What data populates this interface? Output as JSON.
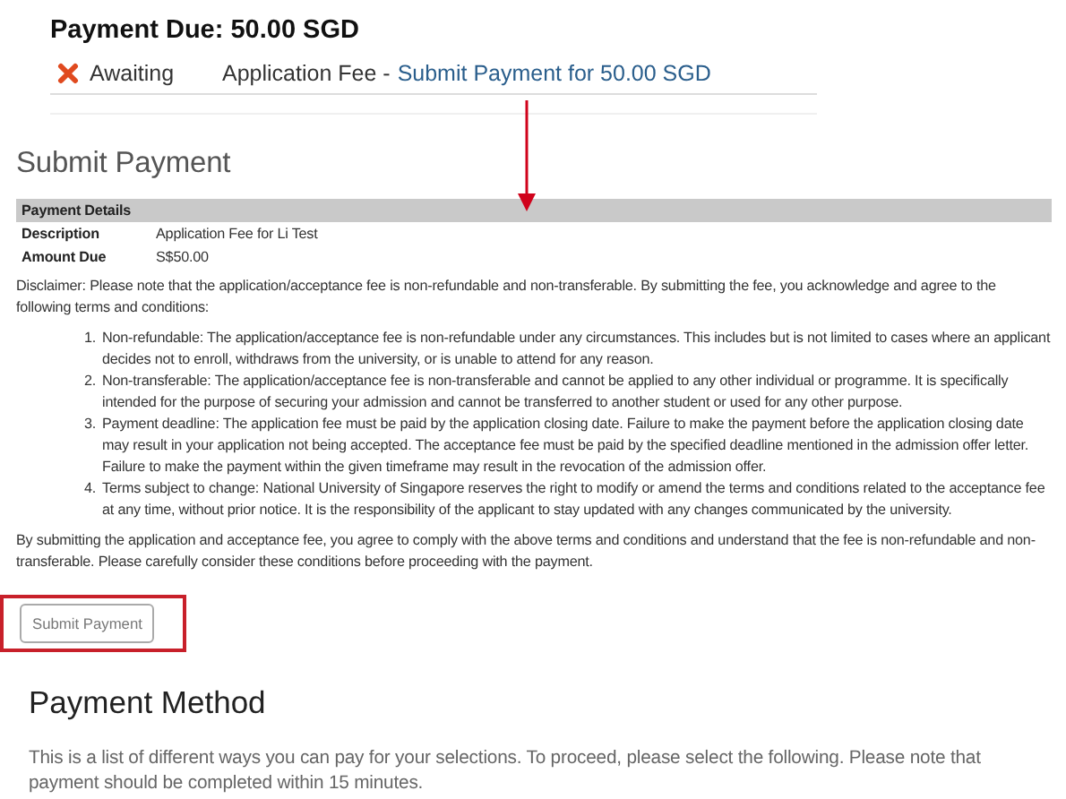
{
  "payment_due": {
    "title": "Payment Due: 50.00 SGD",
    "status": "Awaiting",
    "item": "Application Fee -",
    "link": "Submit Payment for 50.00 SGD"
  },
  "submit_payment": {
    "title": "Submit Payment",
    "details_heading": "Payment Details",
    "rows": [
      {
        "label": "Description",
        "value": "Application Fee for Li Test"
      },
      {
        "label": "Amount Due",
        "value": "S$50.00"
      }
    ],
    "disclaimer": "Disclaimer: Please note that the application/acceptance fee is non-refundable and non-transferable. By submitting the fee, you acknowledge and agree to the following terms and conditions:",
    "terms": [
      {
        "number": "1.",
        "text": "Non-refundable: The application/acceptance fee is non-refundable under any circumstances. This includes but is not limited to cases where an applicant decides not to enroll, withdraws from the university, or is unable to attend for any reason."
      },
      {
        "number": "2.",
        "text": "Non-transferable: The application/acceptance fee is non-transferable and cannot be applied to any other individual or programme. It is specifically intended for the purpose of securing your admission and cannot be transferred to another student or used for any other purpose."
      },
      {
        "number": "3.",
        "text": "Payment deadline: The application fee must be paid by the application closing date. Failure to make the payment before the application closing date may result in your application not being accepted. The acceptance fee must be paid by the specified deadline mentioned in the admission offer letter. Failure to make the payment within the given timeframe may result in the revocation of the admission offer."
      },
      {
        "number": "4.",
        "text": "Terms subject to change: National University of Singapore reserves the right to modify or amend the terms and conditions related to the acceptance fee at any time, without prior notice. It is the responsibility of the applicant to stay updated with any changes communicated by the university."
      }
    ],
    "closing": "By submitting the application and acceptance fee, you agree to comply with the above terms and conditions and understand that the fee is non-refundable and non-transferable. Please carefully consider these conditions before proceeding with the payment.",
    "button": "Submit Payment"
  },
  "payment_method": {
    "title": "Payment Method",
    "text": "This is a list of different ways you can pay for your selections. To proceed, please select the following. Please note that payment should be completed within 15 minutes."
  }
}
